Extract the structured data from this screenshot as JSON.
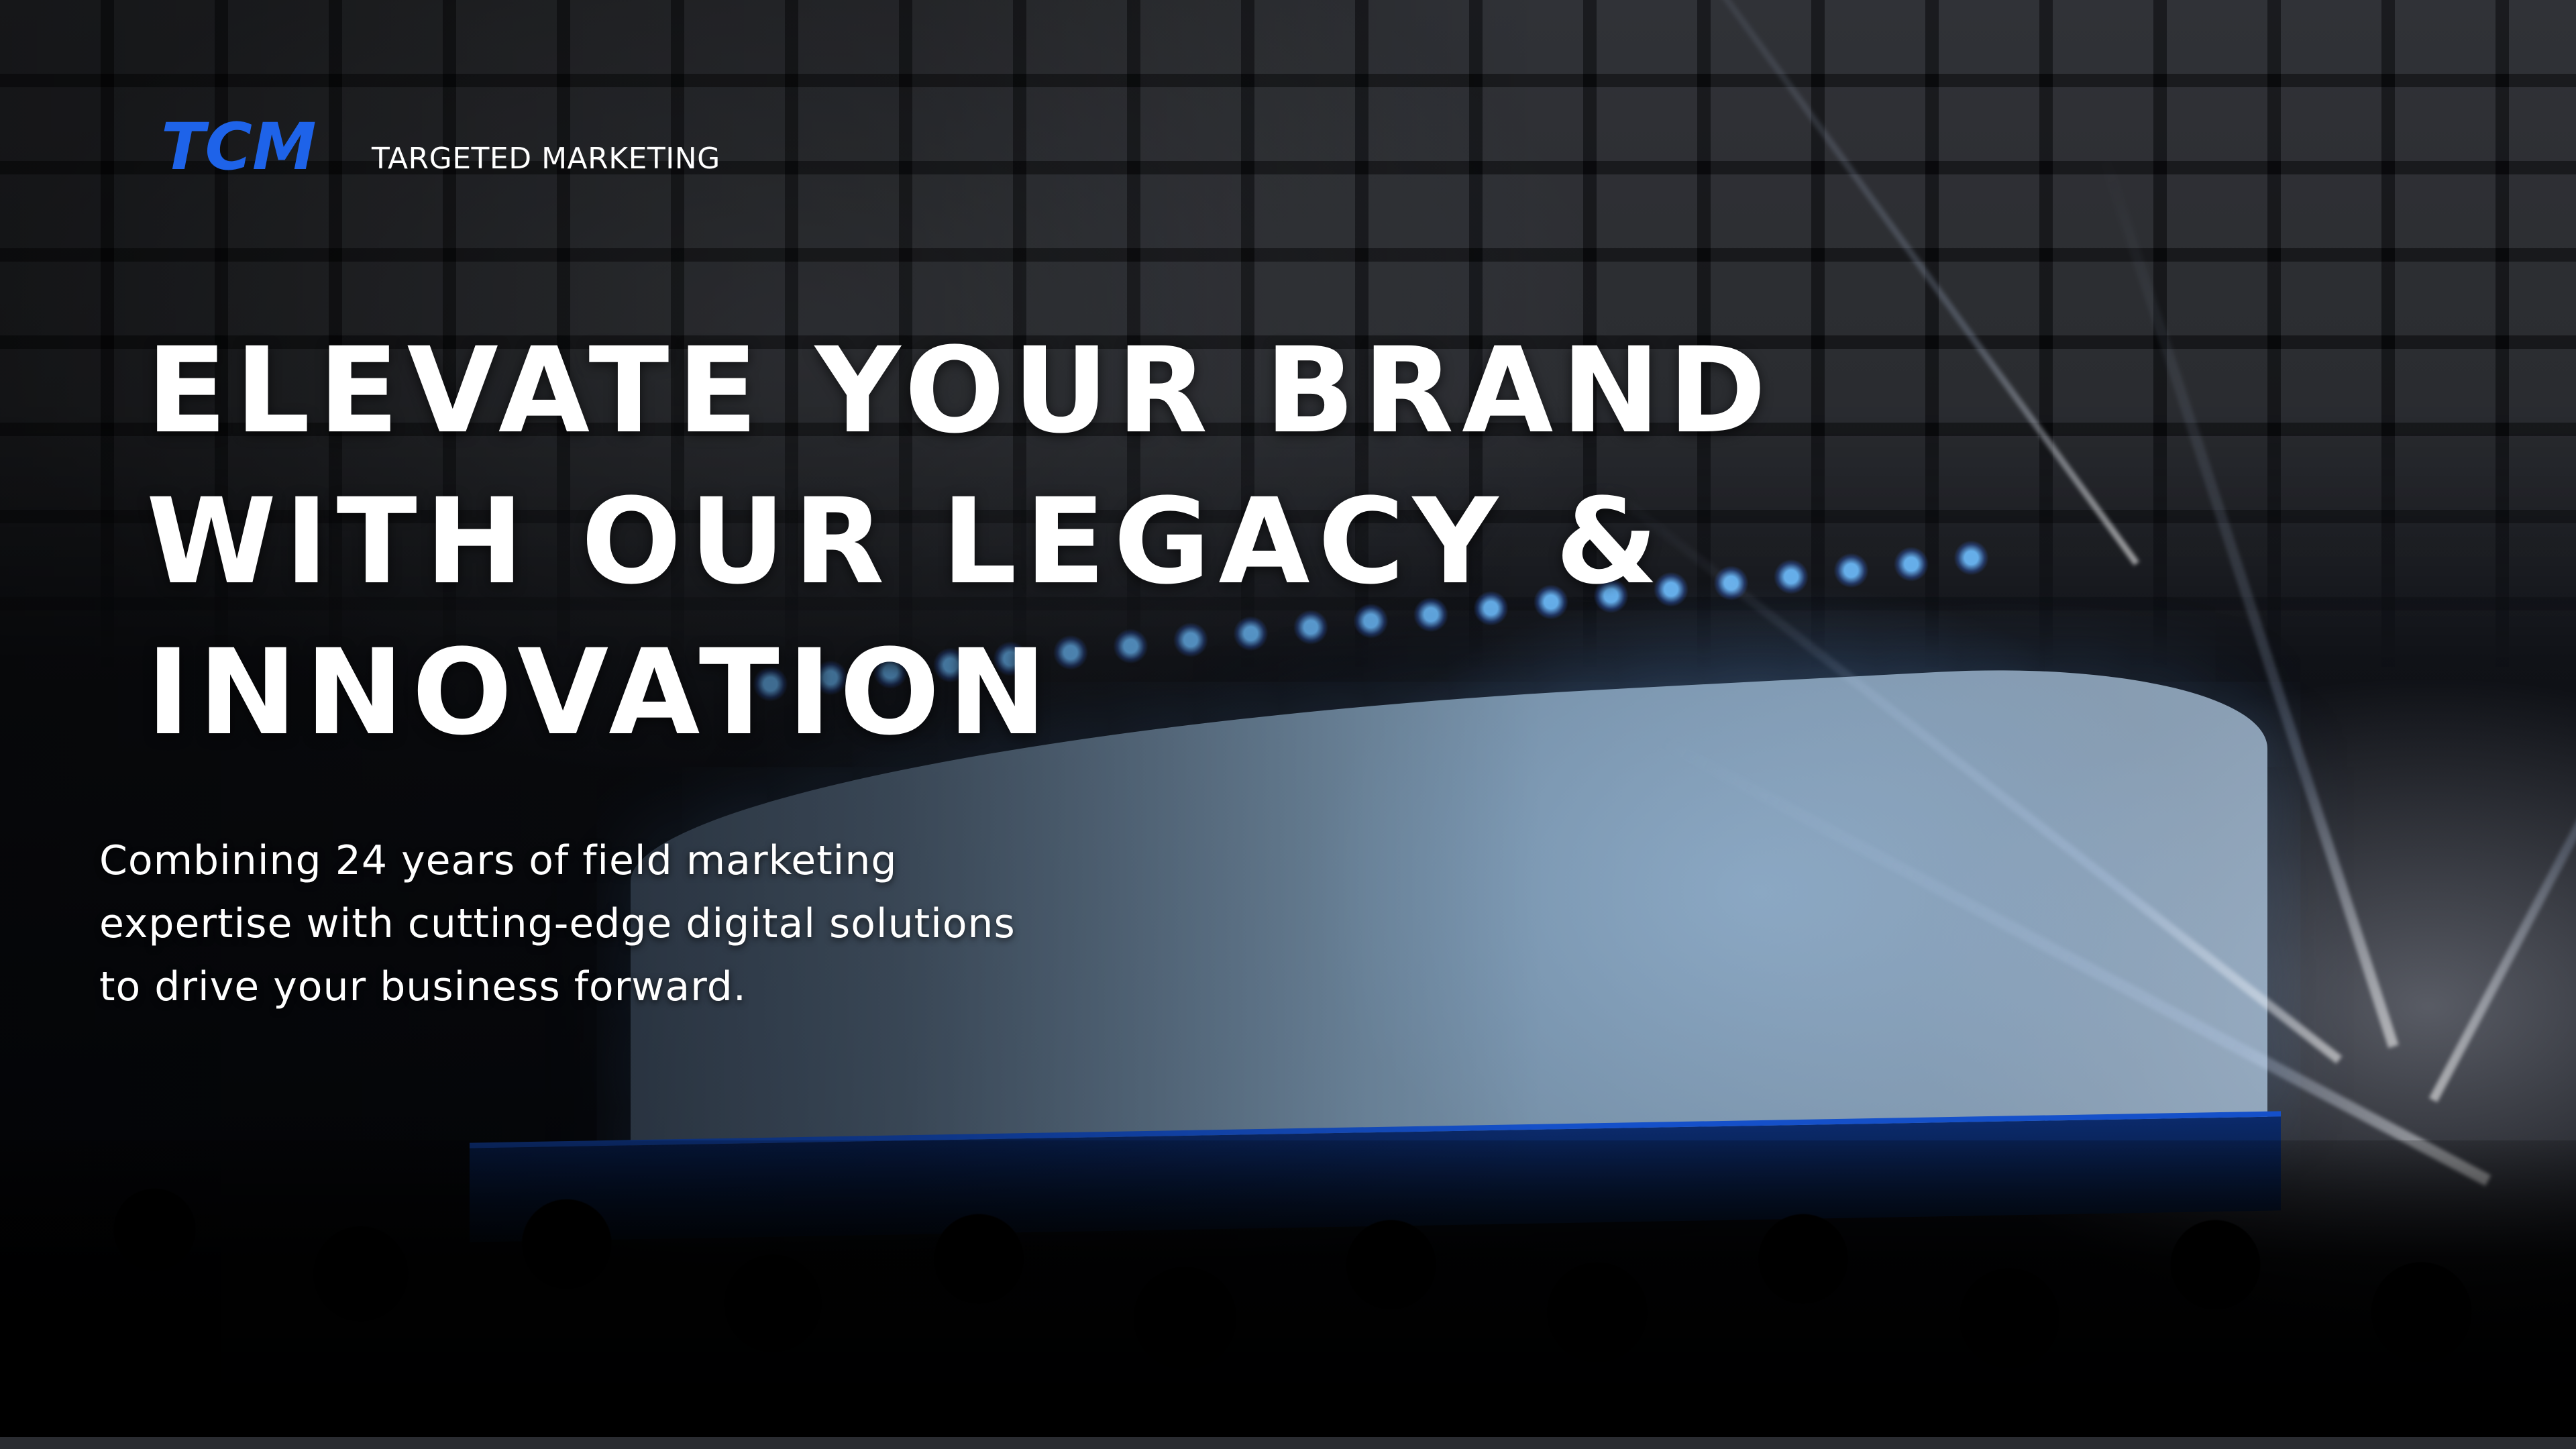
{
  "brand": {
    "logo_text": "TCM",
    "tagline": "TARGETED MARKETING",
    "accent_color": "#1e63e9"
  },
  "hero": {
    "headline_lines": [
      "ELEVATE YOUR BRAND",
      "WITH OUR LEGACY &",
      "INNOVATION"
    ],
    "subcopy": "Combining 24 years of field marketing expertise with cutting-edge digital solutions to drive your business forward.",
    "background_image_description": "event-stage-photo"
  }
}
